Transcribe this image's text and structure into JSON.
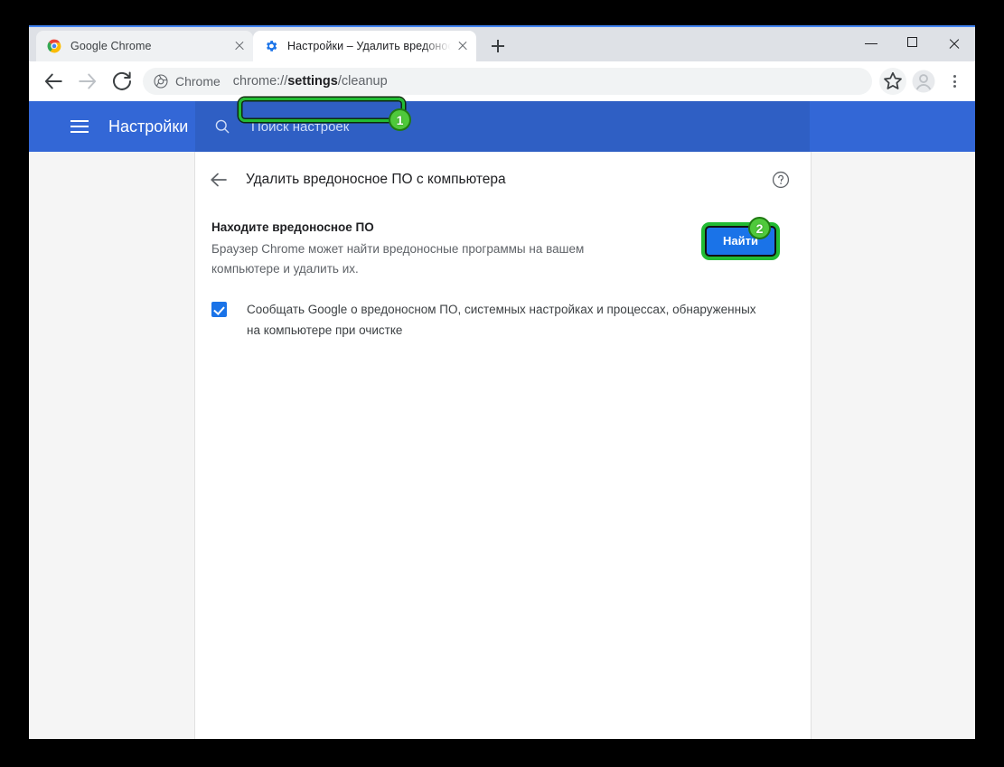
{
  "window": {
    "controls": {
      "minimize": "minimize-button",
      "maximize": "maximize-button",
      "close": "close-button"
    }
  },
  "tabs": [
    {
      "title": "Google Chrome",
      "favicon": "chrome-logo-icon",
      "active": false
    },
    {
      "title": "Настройки – Удалить вредоносное ПО с компьютера",
      "favicon": "settings-gear-icon",
      "active": true
    }
  ],
  "newtab_label": "+",
  "toolbar": {
    "back_icon": "back-arrow-icon",
    "forward_icon": "forward-arrow-icon",
    "reload_icon": "reload-icon",
    "chrome_chip_label": "Chrome",
    "chrome_chip_icon": "chrome-logo-icon",
    "url_prefix": "chrome://",
    "url_bold": "settings",
    "url_suffix": "/cleanup",
    "url_full": "chrome://settings/cleanup",
    "star_icon": "bookmark-star-icon",
    "profile_icon": "profile-avatar-icon",
    "menu_icon": "three-dot-menu-icon"
  },
  "settings_header": {
    "menu_icon": "hamburger-menu-icon",
    "title": "Настройки",
    "search_icon": "search-icon",
    "search_placeholder": "Поиск настроек",
    "background": "#3367d6",
    "search_background": "#2f5fc4"
  },
  "content": {
    "back_icon": "back-arrow-icon",
    "page_title": "Удалить вредоносное ПО с компьютера",
    "help_icon": "help-circle-icon",
    "section": {
      "title": "Находите вредоносное ПО",
      "description": "Браузер Chrome может найти вредоносные программы на вашем компьютере и удалить их.",
      "button_label": "Найти"
    },
    "checkbox": {
      "checked": true,
      "label": "Сообщать Google о вредоносном ПО, системных настройках и процессах, обнаруженных на компьютере при очистке",
      "color": "#1a73e8"
    }
  },
  "callouts": {
    "badge_1": "1",
    "badge_2": "2",
    "highlight_color": "#22bb33"
  }
}
